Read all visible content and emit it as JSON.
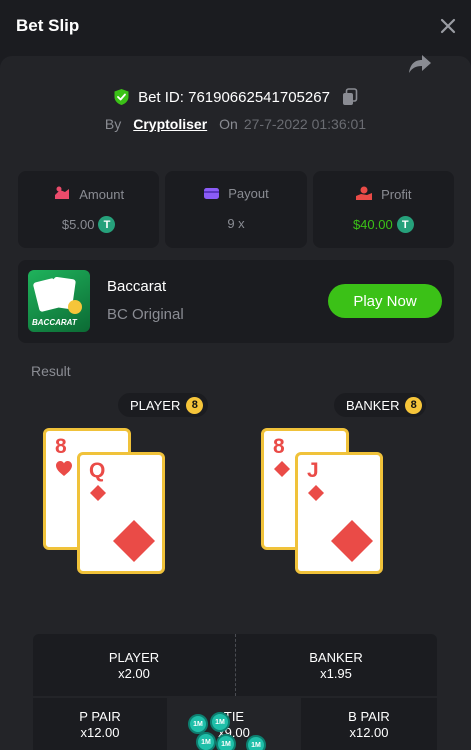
{
  "header": {
    "title": "Bet Slip"
  },
  "bet": {
    "id_text": "Bet ID: 76190662541705267",
    "by_label": "By",
    "user": "Cryptoliser",
    "on_label": "On",
    "date": "27-7-2022 01:36:01"
  },
  "stats": {
    "amount": {
      "label": "Amount",
      "value": "$5.00"
    },
    "payout": {
      "label": "Payout",
      "value": "9 x"
    },
    "profit": {
      "label": "Profit",
      "value": "$40.00"
    }
  },
  "currency_icon": "tether-icon",
  "game": {
    "name": "Baccarat",
    "subtitle": "BC Original",
    "thumb_text": "BACCARAT",
    "play_label": "Play Now"
  },
  "result": {
    "label": "Result",
    "player": {
      "label": "PLAYER",
      "score": "8",
      "cards": [
        {
          "rank": "8",
          "suit": "hearts"
        },
        {
          "rank": "Q",
          "suit": "diamonds"
        }
      ]
    },
    "banker": {
      "label": "BANKER",
      "score": "8",
      "cards": [
        {
          "rank": "8",
          "suit": "diamonds"
        },
        {
          "rank": "J",
          "suit": "diamonds"
        }
      ]
    }
  },
  "bets": {
    "player": {
      "label": "PLAYER",
      "odds": "x2.00"
    },
    "banker": {
      "label": "BANKER",
      "odds": "x1.95"
    },
    "p_pair": {
      "label": "P PAIR",
      "odds": "x12.00"
    },
    "tie": {
      "label": "TIE",
      "odds": "x9.00"
    },
    "b_pair": {
      "label": "B PAIR",
      "odds": "x12.00"
    },
    "chip_label": "1M"
  },
  "colors": {
    "accent_green": "#3bc117",
    "card_red": "#ea4b47",
    "gold": "#f6c53a",
    "bg": "#1b1c20",
    "panel": "#232428"
  }
}
